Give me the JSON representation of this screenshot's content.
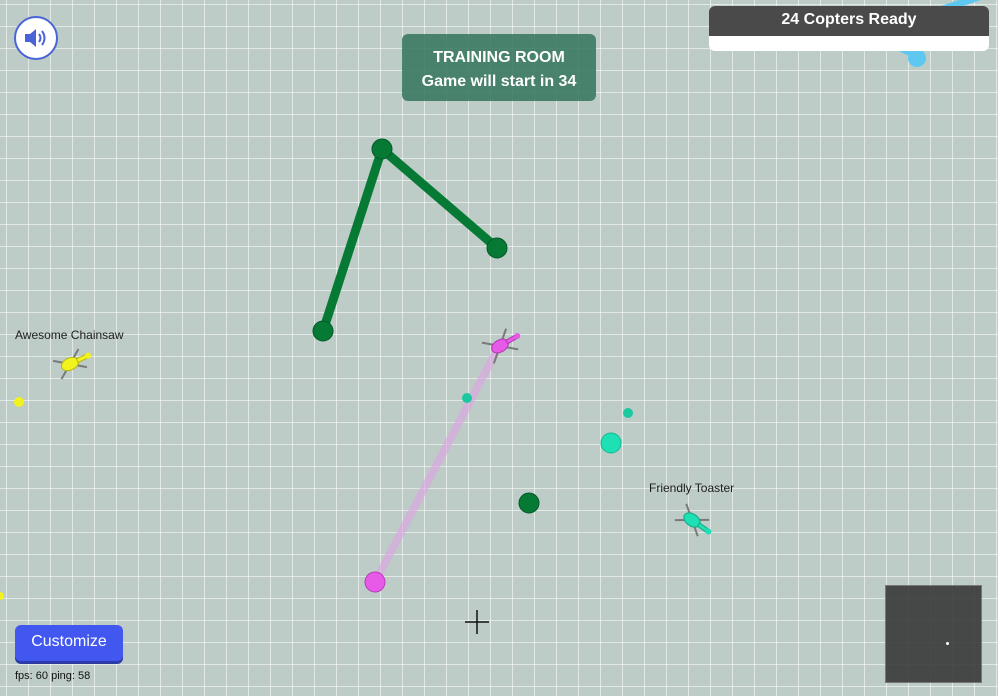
{
  "training": {
    "title": "TRAINING ROOM",
    "countdown": "Game will start in 34"
  },
  "ready": {
    "label": "24 Copters Ready"
  },
  "players": {
    "yellow_name": "Awesome Chainsaw",
    "teal_name": "Friendly Toaster"
  },
  "ui": {
    "customize_label": "Customize",
    "stats": "fps: 60 ping: 58",
    "sound_icon": "speaker-icon"
  },
  "colors": {
    "background": "#bdccc6",
    "dark_green": "#067a34",
    "magenta": "#e75ae8",
    "teal": "#1de0b4",
    "yellow": "#f2f21e",
    "light_blue": "#5ec8f0",
    "button_blue": "#4257f0"
  }
}
